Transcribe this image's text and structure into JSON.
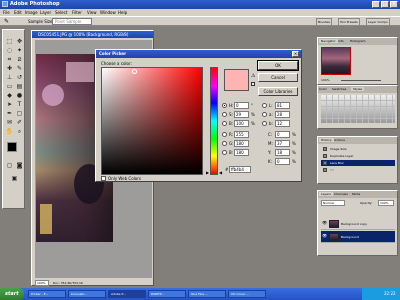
{
  "app": {
    "title": "Adobe Photoshop",
    "window_buttons": [
      "_",
      "□",
      "×"
    ]
  },
  "menubar": [
    "File",
    "Edit",
    "Image",
    "Layer",
    "Select",
    "Filter",
    "View",
    "Window",
    "Help"
  ],
  "options_bar": {
    "sample_size_label": "Sample Size:",
    "sample_size_value": "Point Sample",
    "tabs": [
      "Brushes",
      "Tool Presets",
      "Layer Comps"
    ]
  },
  "document": {
    "title": "DSC05451.JPG @ 100% (Background, RGB/8)",
    "zoom": "100%",
    "doc_info": "Doc: 351.6K/703.1K"
  },
  "color_picker": {
    "title": "Color Picker",
    "choose_label": "Choose a color:",
    "buttons": {
      "ok": "OK",
      "cancel": "Cancel",
      "libraries": "Color Libraries"
    },
    "fields": [
      {
        "label": "H:",
        "value": "0",
        "unit": "°",
        "selected": true
      },
      {
        "label": "S:",
        "value": "29",
        "unit": "%",
        "selected": false
      },
      {
        "label": "B:",
        "value": "100",
        "unit": "%",
        "selected": false
      },
      {
        "label": "R:",
        "value": "255",
        "unit": "",
        "selected": false
      },
      {
        "label": "G:",
        "value": "180",
        "unit": "",
        "selected": false
      },
      {
        "label": "B:",
        "value": "180",
        "unit": "",
        "selected": false
      }
    ],
    "lab_fields": [
      {
        "label": "L:",
        "value": "81"
      },
      {
        "label": "a:",
        "value": "28"
      },
      {
        "label": "b:",
        "value": "12"
      }
    ],
    "cmyk_fields": [
      {
        "label": "C:",
        "value": "0",
        "unit": "%"
      },
      {
        "label": "M:",
        "value": "37",
        "unit": "%"
      },
      {
        "label": "Y:",
        "value": "18",
        "unit": "%"
      },
      {
        "label": "K:",
        "value": "0",
        "unit": "%"
      }
    ],
    "hex_label": "#",
    "hex_value": "ffb4b4",
    "web_colors_label": "Only Web Colors",
    "current_color": "#ffb4b4"
  },
  "panels": {
    "navigator_tabs": [
      "Navigator",
      "Info",
      "Histogram"
    ],
    "swatches_tabs": [
      "Color",
      "Swatches",
      "Styles"
    ],
    "history_tabs": [
      "History",
      "Actions"
    ],
    "history_items": [
      {
        "label": "Image Size",
        "selected": false
      },
      {
        "label": "Duplicate Layer",
        "selected": false
      },
      {
        "label": "Lens Blur",
        "selected": true
      },
      {
        "label": "Fill",
        "selected": false
      }
    ],
    "layers_tabs": [
      "Layers",
      "Channels",
      "Paths"
    ],
    "layers_blend": "Normal",
    "layers_opacity_label": "Opacity:",
    "layers_opacity_value": "100%",
    "layers": [
      {
        "label": "Background copy",
        "selected": false
      },
      {
        "label": "Background",
        "selected": true
      }
    ]
  },
  "taskbar": {
    "start": "start",
    "tasks": [
      {
        "label": "Prober - E...",
        "active": false
      },
      {
        "label": "kovuseki...",
        "active": false
      },
      {
        "label": "Adobe P...",
        "active": true
      },
      {
        "label": "PAINTP...",
        "active": false
      },
      {
        "label": "One Fine ...",
        "active": false
      },
      {
        "label": "CD Cover ...",
        "active": false
      }
    ],
    "clock": "22:22"
  },
  "colors": {
    "title_blue": "#1e44a8",
    "selection_blue": "#0a246a",
    "dialog_grey": "#d4d0c8",
    "picked_color": "#ffb4b4"
  }
}
